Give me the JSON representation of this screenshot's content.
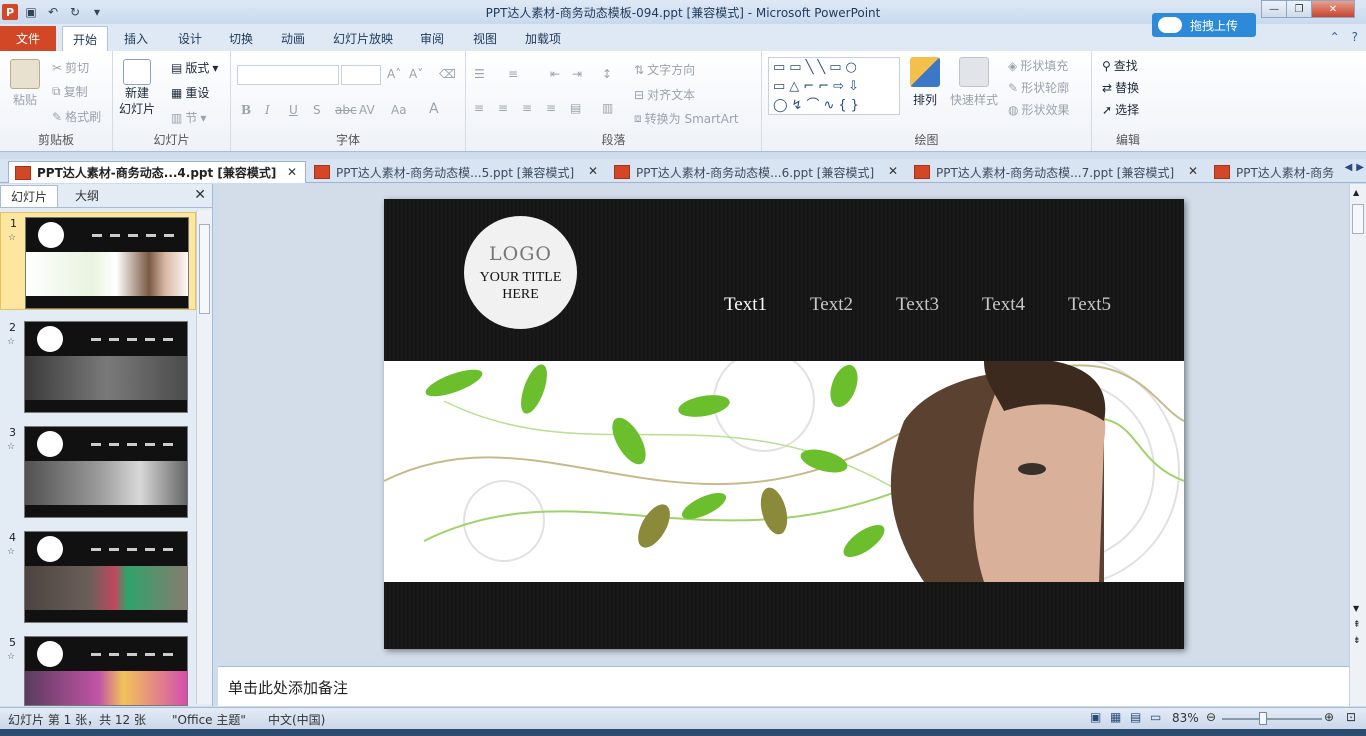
{
  "window": {
    "title": "PPT达人素材-商务动态模板-094.ppt [兼容模式]  -  Microsoft PowerPoint",
    "upload_label": "拖拽上传",
    "app_icon": "P"
  },
  "ribbon_tabs": [
    "文件",
    "开始",
    "插入",
    "设计",
    "切换",
    "动画",
    "幻灯片放映",
    "审阅",
    "视图",
    "加载项"
  ],
  "ribbon": {
    "clipboard": {
      "paste": "粘贴",
      "cut": "剪切",
      "copy": "复制",
      "format_painter": "格式刷",
      "label": "剪贴板"
    },
    "slides": {
      "new_slide_1": "新建",
      "new_slide_2": "幻灯片",
      "layout": "版式",
      "reset": "重设",
      "section": "节",
      "label": "幻灯片"
    },
    "font": {
      "label": "字体"
    },
    "paragraph": {
      "text_direction": "文字方向",
      "align_text": "对齐文本",
      "smartart": "转换为 SmartArt",
      "label": "段落"
    },
    "drawing": {
      "arrange": "排列",
      "quick_styles": "快速样式",
      "shape_fill": "形状填充",
      "shape_outline": "形状轮廓",
      "shape_effects": "形状效果",
      "label": "绘图"
    },
    "editing": {
      "find": "查找",
      "replace": "替换",
      "select": "选择",
      "label": "编辑"
    }
  },
  "doc_tabs": [
    "PPT达人素材-商务动态...4.ppt [兼容模式]",
    "PPT达人素材-商务动态模...5.ppt [兼容模式]",
    "PPT达人素材-商务动态模...6.ppt [兼容模式]",
    "PPT达人素材-商务动态模...7.ppt [兼容模式]",
    "PPT达人素材-商务"
  ],
  "pane": {
    "tab_slides": "幻灯片",
    "tab_outline": "大纲"
  },
  "thumbnails": [
    "1",
    "2",
    "3",
    "4",
    "5"
  ],
  "slide": {
    "logo": "LOGO",
    "title_line1": "YOUR TITLE",
    "title_line2": "HERE",
    "nav": [
      "Text1",
      "Text2",
      "Text3",
      "Text4",
      "Text5"
    ]
  },
  "notes_placeholder": "单击此处添加备注",
  "status": {
    "slide_info": "幻灯片 第 1 张，共 12 张",
    "theme": "\"Office 主题\"",
    "language": "中文(中国)",
    "zoom": "83%"
  }
}
